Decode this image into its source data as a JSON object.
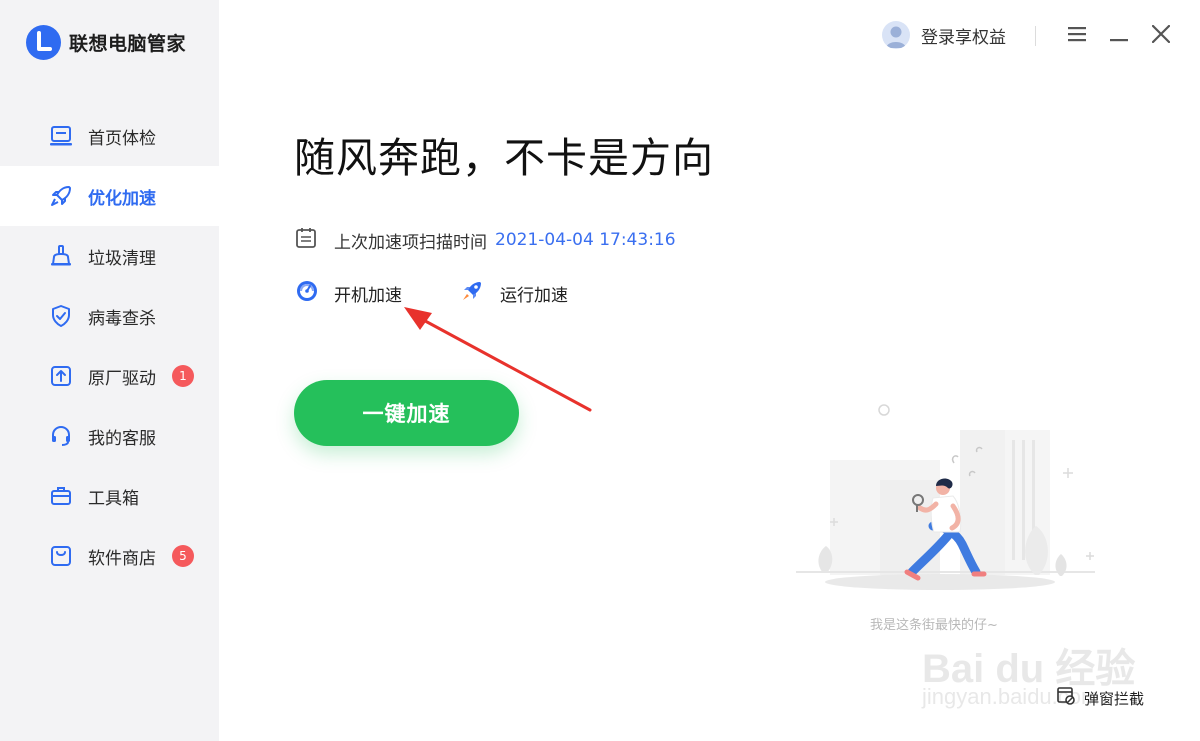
{
  "app": {
    "title": "联想电脑管家"
  },
  "header": {
    "login_label": "登录享权益"
  },
  "sidebar": {
    "items": [
      {
        "label": "首页体检",
        "icon": "laptop-icon",
        "active": false,
        "badge": ""
      },
      {
        "label": "优化加速",
        "icon": "rocket-icon",
        "active": true,
        "badge": ""
      },
      {
        "label": "垃圾清理",
        "icon": "broom-icon",
        "active": false,
        "badge": ""
      },
      {
        "label": "病毒查杀",
        "icon": "shield-icon",
        "active": false,
        "badge": ""
      },
      {
        "label": "原厂驱动",
        "icon": "upload-icon",
        "active": false,
        "badge": "1"
      },
      {
        "label": "我的客服",
        "icon": "headset-icon",
        "active": false,
        "badge": ""
      },
      {
        "label": "工具箱",
        "icon": "toolbox-icon",
        "active": false,
        "badge": ""
      },
      {
        "label": "软件商店",
        "icon": "store-bag-icon",
        "active": false,
        "badge": "5"
      }
    ]
  },
  "main": {
    "headline": "随风奔跑，不卡是方向",
    "scan_label": "上次加速项扫描时间",
    "scan_time": "2021-04-04 17:43:16",
    "modes": [
      {
        "label": "开机加速",
        "icon": "speedometer-icon"
      },
      {
        "label": "运行加速",
        "icon": "rocket-icon"
      }
    ],
    "cta_label": "一键加速",
    "tagline": "我是这条街最快的仔~"
  },
  "footer": {
    "popup_block_label": "弹窗拦截"
  },
  "watermark": {
    "brand": "Bai du 经验",
    "url": "jingyan.baidu.com"
  },
  "colors": {
    "accent": "#2f6bf1",
    "cta": "#25c05b",
    "badge": "#f5595c",
    "sidebar_bg": "#f3f3f5",
    "annotation": "#e8322c"
  }
}
